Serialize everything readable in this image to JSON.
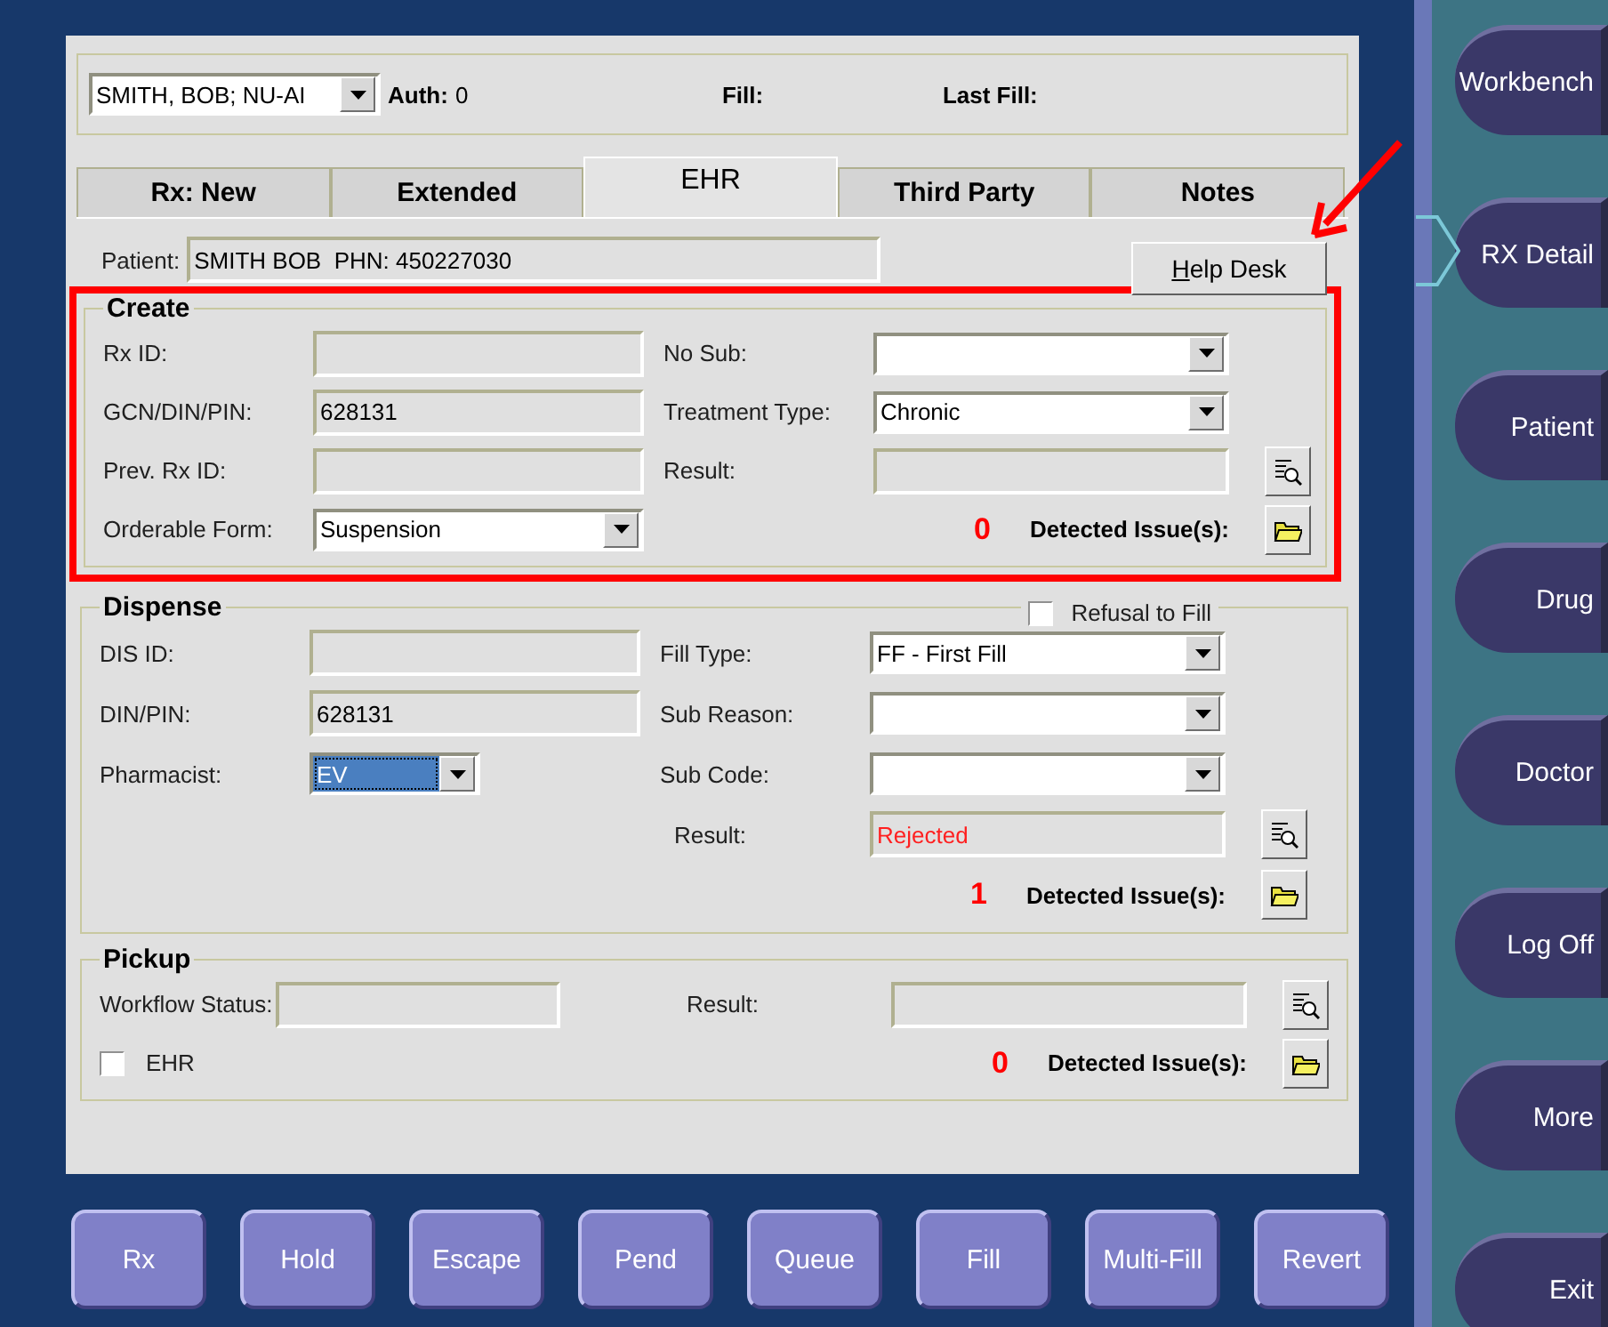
{
  "header": {
    "patient_select": "SMITH, BOB; NU-AI",
    "auth_label": "Auth:",
    "auth_value": "0",
    "fill_label": "Fill:",
    "last_fill_label": "Last Fill:"
  },
  "tabs": [
    {
      "label": "Rx: New",
      "selected": false
    },
    {
      "label": "Extended",
      "selected": false
    },
    {
      "label": "EHR",
      "selected": true
    },
    {
      "label": "Third Party",
      "selected": false
    },
    {
      "label": "Notes",
      "selected": false
    }
  ],
  "patient": {
    "label": "Patient:",
    "value": "SMITH BOB  PHN: 450227030"
  },
  "help_desk_button": "Help Desk",
  "create": {
    "title": "Create",
    "highlighted": true,
    "left_fields": [
      {
        "label": "Rx ID:",
        "kind": "text"
      },
      {
        "label": "GCN/DIN/PIN:",
        "kind": "text",
        "value": "628131"
      },
      {
        "label": "Prev. Rx ID:",
        "kind": "text"
      },
      {
        "label": "Orderable Form:",
        "kind": "dropdown",
        "value": "Suspension",
        "focused": false
      }
    ],
    "right_fields": [
      {
        "label": "No Sub:",
        "kind": "dropdown",
        "focused": false
      },
      {
        "label": "Treatment Type:",
        "kind": "dropdown",
        "value": "Chronic",
        "focused": false
      }
    ],
    "result": {
      "label": "Result:"
    },
    "issue_count": "0",
    "issues_label": "Detected Issue(s):"
  },
  "dispense": {
    "title": "Dispense",
    "refusal_label": "Refusal to Fill",
    "refusal_checked": false,
    "left_fields": [
      {
        "label": "DIS ID:",
        "kind": "text"
      },
      {
        "label": "DIN/PIN:",
        "kind": "text",
        "value": "628131"
      },
      {
        "label": "Pharmacist:",
        "kind": "short-dropdown",
        "value": "EV",
        "focused": true
      }
    ],
    "right_fields": [
      {
        "label": "Fill Type:",
        "kind": "dropdown",
        "value": "FF - First Fill",
        "focused": false
      },
      {
        "label": "Sub Reason:",
        "kind": "dropdown",
        "focused": false
      },
      {
        "label": "Sub Code:",
        "kind": "dropdown",
        "focused": false
      }
    ],
    "result": {
      "label": "Result:",
      "value": "Rejected",
      "alert": true
    },
    "issue_count": "1",
    "issues_label": "Detected Issue(s):"
  },
  "pickup": {
    "title": "Pickup",
    "workflow_label": "Workflow Status:",
    "ehr_label": "EHR",
    "ehr_checked": false,
    "result": {
      "label": "Result:"
    },
    "issue_count": "0",
    "issues_label": "Detected Issue(s):"
  },
  "bottom_buttons": [
    "Rx",
    "Hold",
    "Escape",
    "Pend",
    "Queue",
    "Fill",
    "Multi-Fill",
    "Revert"
  ],
  "sidebar": [
    {
      "label": "Workbench",
      "selected": false
    },
    {
      "label": "RX Detail",
      "selected": true
    },
    {
      "label": "Patient",
      "selected": false
    },
    {
      "label": "Drug",
      "selected": false
    },
    {
      "label": "Doctor",
      "selected": false
    },
    {
      "label": "Log Off",
      "selected": false
    },
    {
      "label": "More",
      "selected": false
    },
    {
      "label": "Exit",
      "selected": false
    }
  ]
}
